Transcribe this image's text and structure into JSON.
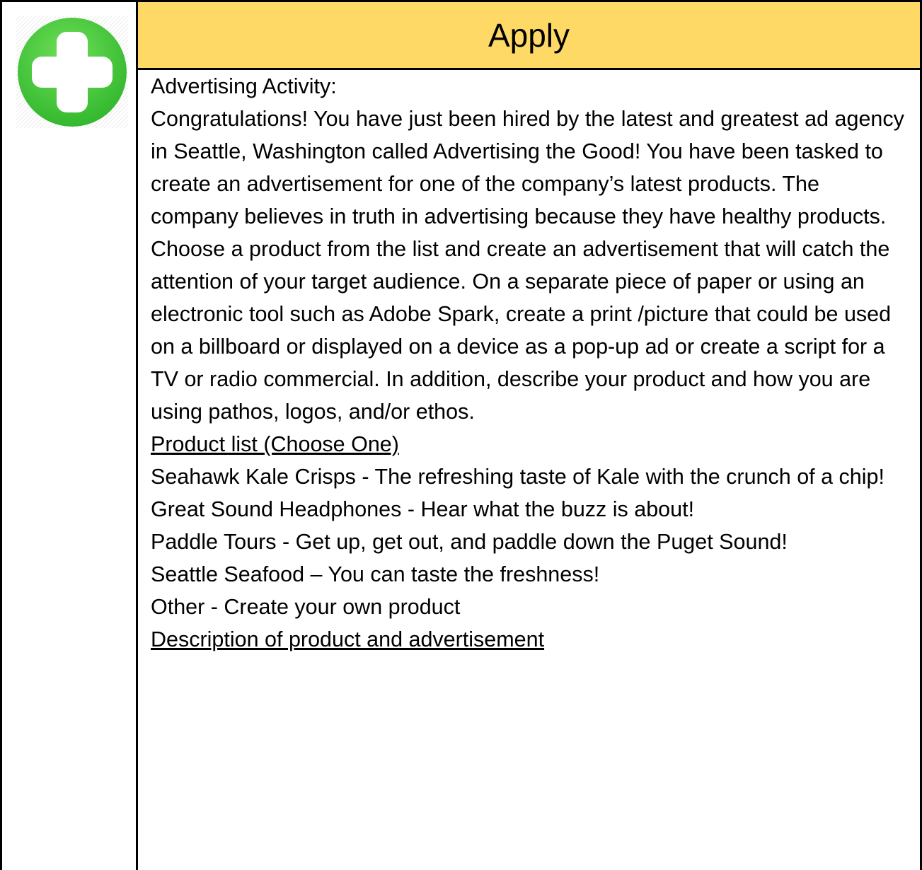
{
  "header": {
    "title": "Apply",
    "background_color": "#ffd966"
  },
  "icon": {
    "name": "plus-circle-icon",
    "color": "#4cd137"
  },
  "content": {
    "activity_label": "Advertising Activity:",
    "intro": "Congratulations!  You have just been hired by the latest and greatest ad agency in Seattle, Washington called Advertising the Good!  You have been tasked to create an advertisement for one of the company’s latest products.  The company believes in truth in  advertising because they have healthy products. Choose a product from the list and create an advertisement that will catch the attention of your target audience.  On a separate piece of paper or using an electronic tool such as Adobe Spark, create a print /picture that could be used on a billboard or displayed on a device as a pop-up ad or create a script for a TV or radio commercial.  In addition, describe your product and how you are using  pathos, logos, and/or ethos.",
    "product_list_heading": "Product list (Choose One)",
    "products": [
      "Seahawk Kale Crisps - The refreshing taste of Kale with the crunch of a chip!",
      "Great Sound Headphones - Hear what the buzz is about!",
      "Paddle Tours - Get up, get out, and paddle down the Puget Sound!",
      "Seattle Seafood  – You can taste the freshness!",
      "Other  - Create your  own product"
    ],
    "description_heading": "Description of product and advertisement  "
  }
}
